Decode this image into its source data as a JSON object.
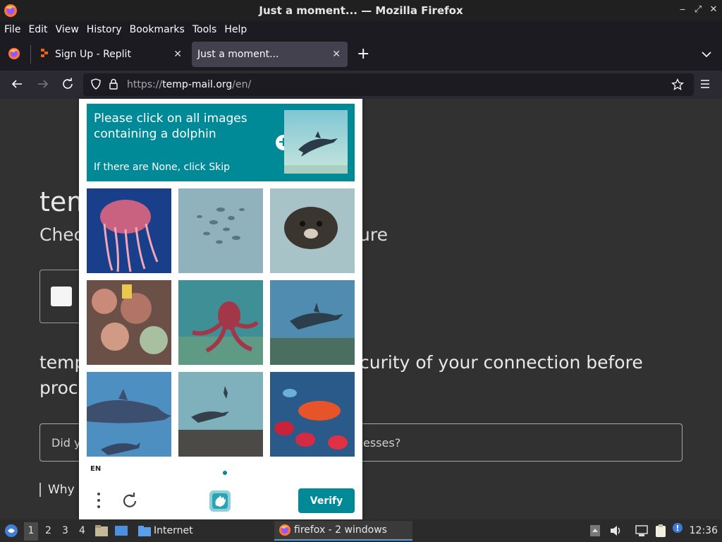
{
  "window": {
    "title": "Just a moment... — Mozilla Firefox"
  },
  "menubar": {
    "items": [
      "File",
      "Edit",
      "View",
      "History",
      "Bookmarks",
      "Tools",
      "Help"
    ]
  },
  "tabs": [
    {
      "label": "Sign Up - Replit",
      "active": false
    },
    {
      "label": "Just a moment...",
      "active": true
    }
  ],
  "navbar": {
    "url_scheme": "https://",
    "url_domain": "temp-mail.org",
    "url_path": "/en/"
  },
  "page": {
    "heading": "tem",
    "subheading": "Chec",
    "subheading_tail": "ure",
    "paragraph_line1_start": "temp",
    "paragraph_line1_end": "curity of your connection before",
    "paragraph_line2_start": "proc",
    "input_start": "Did y",
    "input_end": "esses?",
    "why_text": "Why a"
  },
  "captcha": {
    "prompt": "Please click on all images containing a dolphin",
    "note": "If there are None, click Skip",
    "plus_glyph": "+",
    "language": "EN",
    "verify_label": "Verify",
    "accent_color": "#008a97",
    "tiles": [
      {
        "content": "jellyfish"
      },
      {
        "content": "fish school"
      },
      {
        "content": "seal"
      },
      {
        "content": "coral reef"
      },
      {
        "content": "octopus"
      },
      {
        "content": "dolphin"
      },
      {
        "content": "dolphins"
      },
      {
        "content": "dolphin over reef"
      },
      {
        "content": "tropical fish"
      }
    ]
  },
  "taskbar": {
    "workspaces": [
      "1",
      "2",
      "3",
      "4"
    ],
    "folder_label": "Internet",
    "task_label": "firefox - 2 windows",
    "clock": "12:36"
  }
}
